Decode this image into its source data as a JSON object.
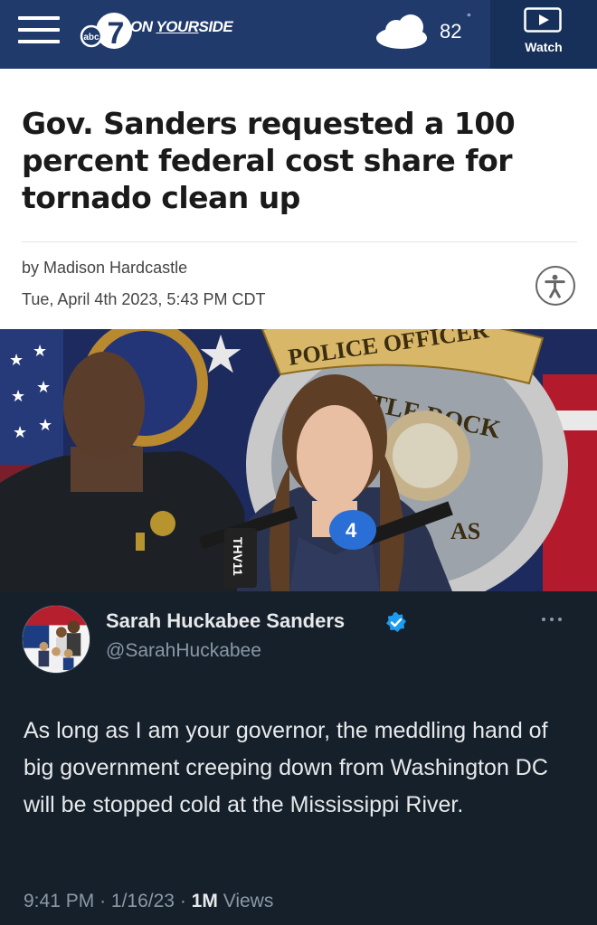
{
  "header": {
    "logo_badge": "abc",
    "logo_number": "7",
    "brand_on": "ON ",
    "brand_your": "YOUR",
    "brand_side": "SIDE",
    "weather_icon": "cloud-icon",
    "temperature": "82",
    "degree_symbol": "°",
    "watch_label": "Watch",
    "watch_icon": "play-icon",
    "menu_icon": "hamburger-menu-icon",
    "colors": {
      "bar": "#1f3a6b",
      "watch_panel": "#163059"
    }
  },
  "article": {
    "headline": "Gov. Sanders requested a 100 percent federal cost share for tornado clean up",
    "byline": "by Madison Hardcastle",
    "date": "Tue, April 4th 2023, 5:43 PM CDT",
    "accessibility_icon": "accessibility-icon"
  },
  "photo": {
    "badge_text_top": "POLICE OFFICER",
    "badge_text_mid": "LITTLE ROCK",
    "badge_text_bottom": "AS",
    "mic_label": "THV11",
    "mic_number": "4"
  },
  "tweet": {
    "author_name": "Sarah Huckabee Sanders",
    "handle": "@SarahHuckabee",
    "verified_icon": "verified-badge-icon",
    "more_icon": "more-options-icon",
    "text": "As long as I am your governor, the meddling hand of big government creeping down from Washington DC will be stopped cold at the Mississippi River.",
    "time": "9:41 PM",
    "separator": "·",
    "date": "1/16/23",
    "views_count": "1M",
    "views_label": "Views",
    "colors": {
      "background": "#15202b",
      "primary_text": "#e7e9ea",
      "secondary_text": "#8b98a5",
      "verified": "#1d9bf0"
    }
  }
}
